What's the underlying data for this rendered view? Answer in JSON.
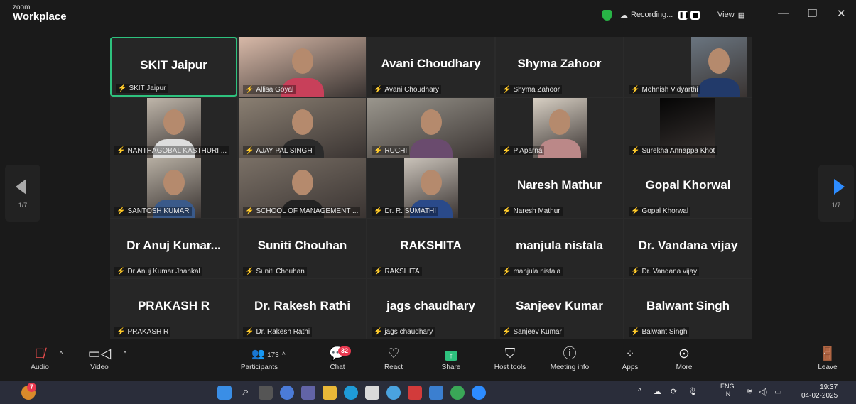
{
  "app": {
    "brand_small": "zoom",
    "brand_big": "Workplace"
  },
  "titlebar": {
    "recording_label": "Recording...",
    "view_label": "View"
  },
  "gallery": {
    "page_indicator_left": "1/7",
    "page_indicator_right": "1/7",
    "tiles": [
      {
        "big": "SKIT Jaipur",
        "label": "SKIT Jaipur",
        "active": true
      },
      {
        "big": "",
        "label": "Allisa Goyal",
        "video": true
      },
      {
        "big": "Avani Choudhary",
        "label": "Avani Choudhary"
      },
      {
        "big": "Shyma Zahoor",
        "label": "Shyma Zahoor"
      },
      {
        "big": "",
        "label": "Mohnish Vidyarthi",
        "video": true
      },
      {
        "big": "",
        "label": "NANTHAGOBAL KASTHURI ...",
        "video": true
      },
      {
        "big": "",
        "label": "AJAY PAL SINGH",
        "video": true
      },
      {
        "big": "",
        "label": "RUCHI",
        "video": true
      },
      {
        "big": "",
        "label": "P Aparna",
        "video": true
      },
      {
        "big": "",
        "label": "Surekha Annappa Khot",
        "video": true
      },
      {
        "big": "",
        "label": "SANTOSH KUMAR",
        "video": true
      },
      {
        "big": "",
        "label": "SCHOOL OF MANAGEMENT ...",
        "video": true
      },
      {
        "big": "",
        "label": "Dr. R. SUMATHI",
        "video": true
      },
      {
        "big": "Naresh Mathur",
        "label": "Naresh Mathur"
      },
      {
        "big": "Gopal Khorwal",
        "label": "Gopal Khorwal"
      },
      {
        "big": "Dr Anuj  Kumar...",
        "label": "Dr Anuj Kumar Jhankal"
      },
      {
        "big": "Suniti Chouhan",
        "label": "Suniti Chouhan"
      },
      {
        "big": "RAKSHITA",
        "label": "RAKSHITA"
      },
      {
        "big": "manjula nistala",
        "label": "manjula nistala"
      },
      {
        "big": "Dr. Vandana vijay",
        "label": "Dr. Vandana vijay"
      },
      {
        "big": "PRAKASH R",
        "label": "PRAKASH R"
      },
      {
        "big": "Dr. Rakesh Rathi",
        "label": "Dr. Rakesh Rathi"
      },
      {
        "big": "jags chaudhary",
        "label": "jags chaudhary"
      },
      {
        "big": "Sanjeev Kumar",
        "label": "Sanjeev Kumar"
      },
      {
        "big": "Balwant Singh",
        "label": "Balwant Singh"
      }
    ]
  },
  "toolbar": {
    "audio": "Audio",
    "video": "Video",
    "participants": "Participants",
    "participants_count": "173",
    "chat": "Chat",
    "chat_badge": "32",
    "react": "React",
    "share": "Share",
    "host_tools": "Host tools",
    "meeting_info": "Meeting info",
    "apps": "Apps",
    "more": "More",
    "leave": "Leave"
  },
  "taskbar": {
    "weather_badge": "7",
    "lang_top": "ENG",
    "lang_bottom": "IN",
    "time": "19:37",
    "date": "04-02-2025"
  },
  "colors": {
    "active_border": "#2ec27e",
    "mic_muted": "#e84d4d",
    "badge": "#e8384f",
    "leave": "#e8384f"
  }
}
